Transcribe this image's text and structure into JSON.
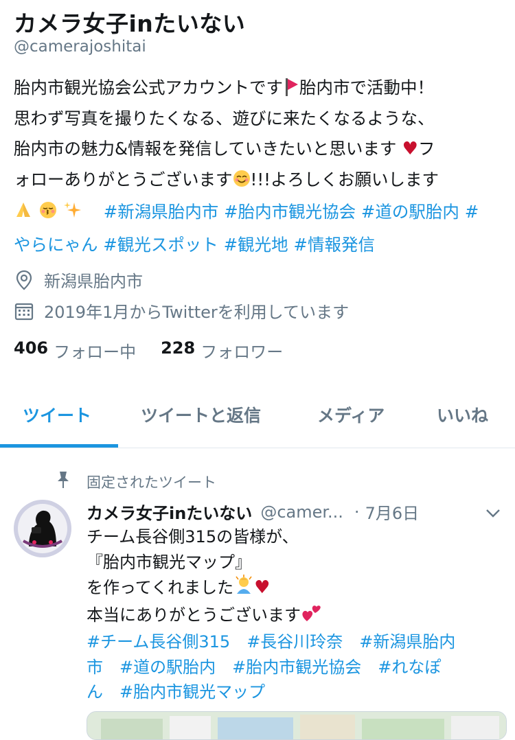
{
  "profile": {
    "name": "カメラ女子inたいない",
    "handle": "@camerajoshitai",
    "bio": {
      "l1a": "胎内市観光協会公式アカウントです",
      "l1b": "胎内市で活動中！",
      "l2": "思わず写真を撮りたくなる、遊びに来たくなるような、",
      "l3a": "胎内市の魅力&情報を発信していきたいと思います",
      "l3b": "フ",
      "l4a": "ォローありがとうございます",
      "l4b": "!!!よろしくお願いします",
      "l5tags": "#新潟県胎内市 #胎内市観光協会 #道の駅胎内 #",
      "l6tags": "やらにゃん #観光スポット #観光地 #情報発信"
    },
    "location": "新潟県胎内市",
    "joined": "2019年1月からTwitterを利用しています",
    "following_count": "406",
    "following_label": "フォロー中",
    "followers_count": "228",
    "followers_label": "フォロワー"
  },
  "tabs": [
    "ツイート",
    "ツイートと返信",
    "メディア",
    "いいね"
  ],
  "tweet": {
    "pinned_label": "固定されたツイート",
    "author": "カメラ女子inたいない",
    "handle": "@camer...",
    "dot": "·",
    "date": "7月6日",
    "line1": "チーム長谷側315の皆様が、",
    "line2": "『胎内市観光マップ』",
    "line3": "を作ってくれました",
    "line4": "本当にありがとうございます",
    "tags1": "#チーム長谷側315　#長谷川玲奈　#新潟県胎内",
    "tags2": "市　#道の駅胎内　#胎内市観光協会　#れなぽ",
    "tags3": "ん　#胎内市観光マップ"
  },
  "colors": {
    "accent": "#1b95e0",
    "secondary_text": "#657786",
    "border": "#e1e8ed"
  }
}
